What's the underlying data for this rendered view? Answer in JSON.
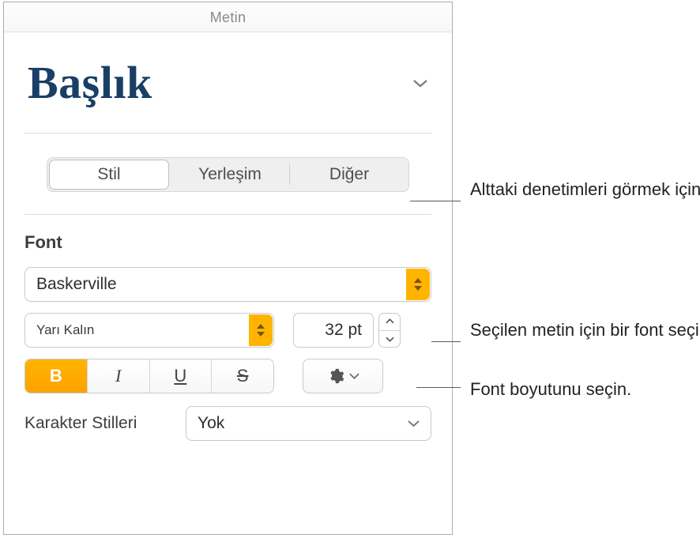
{
  "panel": {
    "title": "Metin",
    "paragraph_style": "Başlık"
  },
  "tabs": {
    "style": "Stil",
    "layout": "Yerleşim",
    "more": "Diğer"
  },
  "font_section": {
    "label": "Font",
    "family": "Baskerville",
    "weight": "Yarı Kalın",
    "size": "32 pt"
  },
  "biuso": {
    "bold": "B",
    "italic": "I",
    "underline": "U",
    "strike": "S"
  },
  "char_styles": {
    "label": "Karakter Stilleri",
    "value": "Yok"
  },
  "callouts": {
    "tabs": "Alttaki denetimleri görmek için tıklayın.",
    "font": "Seçilen metin için bir font seçin.",
    "size": "Font boyutunu seçin."
  }
}
